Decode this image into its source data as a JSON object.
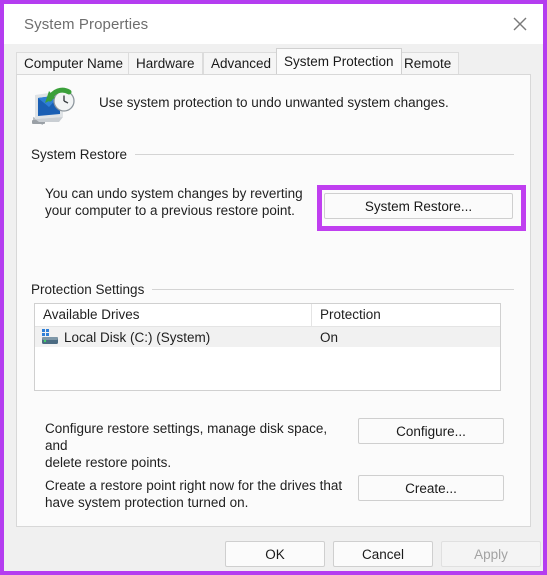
{
  "window": {
    "title": "System Properties",
    "close_icon": "close-icon"
  },
  "tabs": [
    {
      "label": "Computer Name",
      "active": false
    },
    {
      "label": "Hardware",
      "active": false
    },
    {
      "label": "Advanced",
      "active": false
    },
    {
      "label": "System Protection",
      "active": true
    },
    {
      "label": "Remote",
      "active": false
    }
  ],
  "header": {
    "icon": "system-protection-icon",
    "description": "Use system protection to undo unwanted system changes."
  },
  "system_restore": {
    "group_label": "System Restore",
    "description_line1": "You can undo system changes by reverting",
    "description_line2": "your computer to a previous restore point.",
    "button_label": "System Restore...",
    "highlight_color": "#c03ff0"
  },
  "protection_settings": {
    "group_label": "Protection Settings",
    "columns": [
      "Available Drives",
      "Protection"
    ],
    "rows": [
      {
        "icon": "hard-disk-icon",
        "drive": "Local Disk (C:) (System)",
        "protection": "On",
        "selected": true
      }
    ],
    "configure": {
      "description_line1": "Configure restore settings, manage disk space, and",
      "description_line2": "delete restore points.",
      "button_label": "Configure..."
    },
    "create": {
      "description_line1": "Create a restore point right now for the drives that",
      "description_line2": "have system protection turned on.",
      "button_label": "Create..."
    }
  },
  "footer": {
    "ok_label": "OK",
    "cancel_label": "Cancel",
    "apply_label": "Apply",
    "apply_disabled": true
  }
}
